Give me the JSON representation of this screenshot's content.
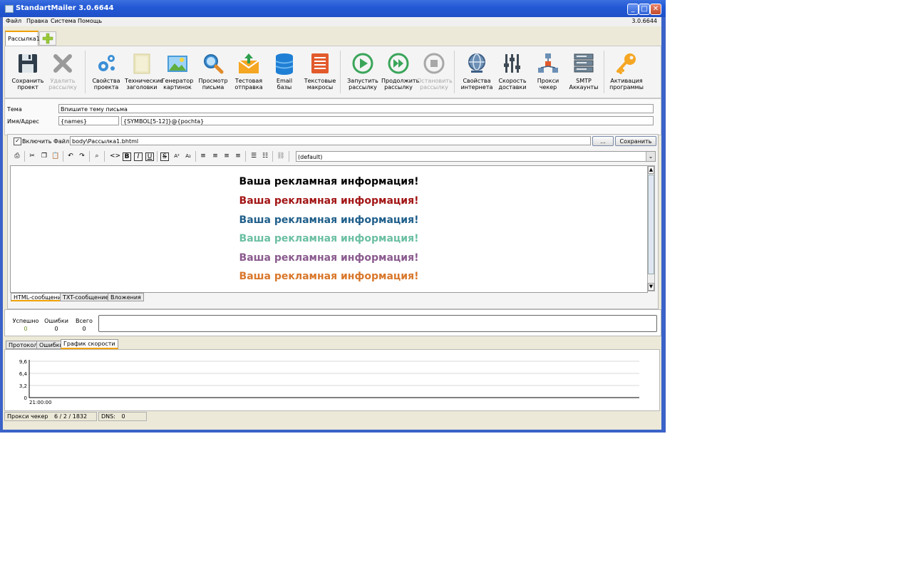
{
  "window": {
    "title": "StandartMailer 3.0.6644",
    "version": "3.0.6644"
  },
  "menu": [
    "Файл",
    "Правка",
    "Система",
    "Помощь"
  ],
  "tabs": {
    "active": "Рассылка1"
  },
  "toolbar": [
    {
      "label1": "Сохранить",
      "label2": "проект",
      "icon": "save-icon",
      "enabled": true
    },
    {
      "label1": "Удалить",
      "label2": "рассылку",
      "icon": "delete-icon",
      "enabled": false
    },
    {
      "label1": "Свойства",
      "label2": "проекта",
      "icon": "gears-icon",
      "enabled": true
    },
    {
      "label1": "Технические",
      "label2": "заголовки",
      "icon": "note-icon",
      "enabled": true
    },
    {
      "label1": "Генератор",
      "label2": "картинок",
      "icon": "image-icon",
      "enabled": true
    },
    {
      "label1": "Просмотр",
      "label2": "письма",
      "icon": "magnifier-icon",
      "enabled": true
    },
    {
      "label1": "Тестовая",
      "label2": "отправка",
      "icon": "test-send-icon",
      "enabled": true
    },
    {
      "label1": "Email",
      "label2": "базы",
      "icon": "database-icon",
      "enabled": true
    },
    {
      "label1": "Текстовые",
      "label2": "макросы",
      "icon": "macros-icon",
      "enabled": true
    },
    {
      "label1": "Запустить",
      "label2": "рассылку",
      "icon": "play-icon",
      "enabled": true
    },
    {
      "label1": "Продолжить",
      "label2": "рассылку",
      "icon": "resume-icon",
      "enabled": true
    },
    {
      "label1": "Остановить",
      "label2": "рассылку",
      "icon": "stop-icon",
      "enabled": false
    },
    {
      "label1": "Свойства",
      "label2": "интернета",
      "icon": "globe-icon",
      "enabled": true
    },
    {
      "label1": "Скорость",
      "label2": "доставки",
      "icon": "sliders-icon",
      "enabled": true
    },
    {
      "label1": "Прокси",
      "label2": "чекер",
      "icon": "network-icon",
      "enabled": true
    },
    {
      "label1": "SMTP",
      "label2": "Аккаунты",
      "icon": "server-icon",
      "enabled": true
    },
    {
      "label1": "Активация",
      "label2": "программы",
      "icon": "key-icon",
      "enabled": true
    }
  ],
  "form": {
    "subject_label": "Тема",
    "subject_value": "Впишите тему письма",
    "name_label": "Имя/Адрес",
    "name_value": "{names}",
    "address_value": "{SYMBOL[5-12]}@{pochta}"
  },
  "editor": {
    "include_file_label": "Включить Файл :",
    "include_file_path": "body\\Рассылка1.bhtml",
    "browse_label": "...",
    "save_label": "Сохранить",
    "font_select": "(default)",
    "ad_lines": [
      {
        "text": "Ваша рекламная информация!",
        "color": "#000000"
      },
      {
        "text": "Ваша рекламная информация!",
        "color": "#a31515"
      },
      {
        "text": "Ваша рекламная информация!",
        "color": "#1f5f8b"
      },
      {
        "text": "Ваша рекламная информация!",
        "color": "#6bbfa3"
      },
      {
        "text": "Ваша рекламная информация!",
        "color": "#8a5a8e"
      },
      {
        "text": "Ваша рекламная информация!",
        "color": "#d9772b"
      }
    ],
    "bottom_tabs": [
      "HTML-сообщение",
      "TXT-сообщение",
      "Вложения"
    ]
  },
  "stats": {
    "success_label": "Успешно",
    "success_value": "0",
    "errors_label": "Ошибки",
    "errors_value": "0",
    "total_label": "Всего",
    "total_value": "0"
  },
  "log_tabs": [
    "Протокол",
    "Ошибки",
    "График скорости"
  ],
  "chart_data": {
    "type": "line",
    "x": [
      "21:00:00"
    ],
    "series": [
      {
        "values": [
          0
        ]
      }
    ],
    "y_ticks": [
      "9,6",
      "6,4",
      "3,2",
      "0"
    ],
    "ylim": [
      0,
      9.6
    ],
    "grid": true
  },
  "statusbar": {
    "proxy_label": "Прокси чекер",
    "proxy_value": "6 / 2 / 1832",
    "dns_label": "DNS:",
    "dns_value": "0"
  }
}
